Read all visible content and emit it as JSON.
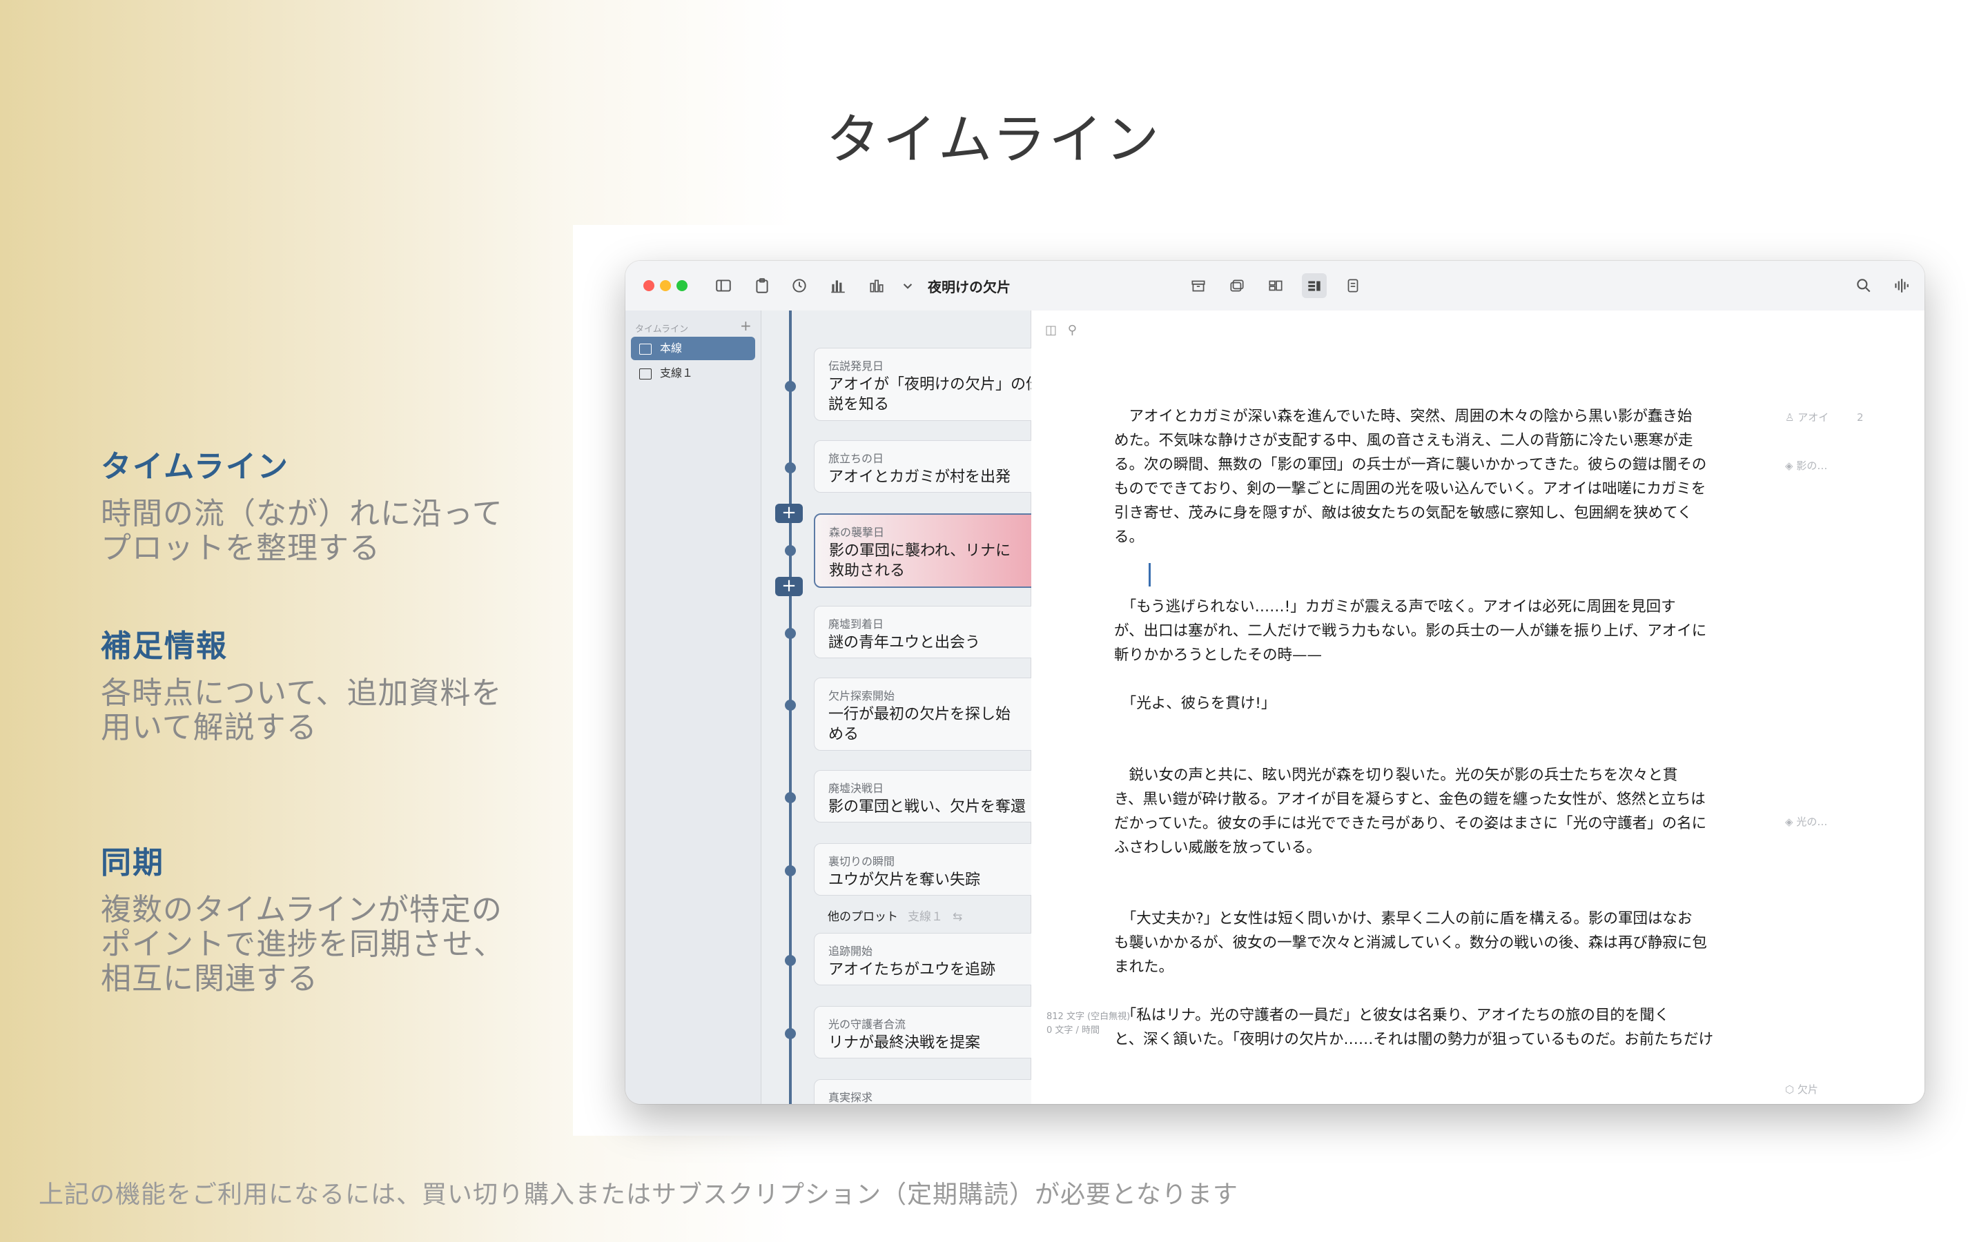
{
  "hero": {
    "title": "タイムライン"
  },
  "features": [
    {
      "title": "タイムライン",
      "desc_lines": [
        "時間の流（なが）れに沿って",
        "プロットを整理する"
      ]
    },
    {
      "title": "補足情報",
      "desc_lines": [
        "各時点について、追加資料を",
        "用いて解説する"
      ]
    },
    {
      "title": "同期",
      "desc_lines": [
        "複数のタイムラインが特定の",
        "ポイントで進捗を同期させ、",
        "相互に関連する"
      ]
    }
  ],
  "footnote": "上記の機能をご利用になるには、買い切り購入またはサブスクリプション（定期購読）が必要となります",
  "window": {
    "traffic_lights": {
      "close": "#ff5f57",
      "minimize": "#febc2e",
      "zoom": "#28c840"
    },
    "toolbar": {
      "document_title": "夜明けの欠片",
      "left_icons": [
        "sidebar-icon",
        "clipboard-icon",
        "clock-icon",
        "bar-chart-icon",
        "columns-chart-icon",
        "chevron-down-icon"
      ],
      "right_icons": [
        "archive-icon",
        "windows-icon",
        "layout-icon",
        "split-view-icon",
        "document-icon"
      ],
      "far_right_icons": [
        "search-icon",
        "waveform-icon"
      ]
    },
    "sidebar": {
      "header": "タイムライン",
      "add": "+",
      "items": [
        {
          "label": "本線",
          "selected": true
        },
        {
          "label": "支線１",
          "selected": false
        }
      ]
    },
    "timeline": {
      "cards": [
        {
          "date": "伝説発見日",
          "event": [
            "アオイが「夜明けの欠片」の伝",
            "説を知る"
          ]
        },
        {
          "date": "旅立ちの日",
          "event": [
            "アオイとカガミが村を出発"
          ]
        },
        {
          "date": "森の襲撃日",
          "event": [
            "影の軍団に襲われ、リナに",
            "救助される"
          ],
          "selected": true
        },
        {
          "date": "廃墟到着日",
          "event": [
            "謎の青年ユウと出会う"
          ]
        },
        {
          "date": "欠片探索開始",
          "event": [
            "一行が最初の欠片を探し始",
            "める"
          ]
        },
        {
          "date": "廃墟決戦日",
          "event": [
            "影の軍団と戦い、欠片を奪還"
          ]
        },
        {
          "date": "裏切りの瞬間",
          "event": [
            "ユウが欠片を奪い失踪"
          ]
        },
        {
          "date": "追跡開始",
          "event": [
            "アオイたちがユウを追跡"
          ]
        },
        {
          "date": "光の守護者合流",
          "event": [
            "リナが最終決戦を提案"
          ]
        },
        {
          "date": "真実探求",
          "event": []
        }
      ],
      "other_plot": {
        "label": "他のプロット",
        "sub": "支線１",
        "icon": "swap-icon"
      },
      "add_button": "+"
    },
    "editor": {
      "paragraphs": [
        [
          "　アオイとカガミが深い森を進んでいた時、突然、周囲の木々の陰から黒い影が蠢き始",
          "めた。不気味な静けさが支配する中、風の音さえも消え、二人の背筋に冷たい悪寒が走",
          "る。次の瞬間、無数の「影の軍団」の兵士が一斉に襲いかかってきた。彼らの鎧は闇その",
          "ものでできており、剣の一撃ごとに周囲の光を吸い込んでいく。アオイは咄嗟にカガミを",
          "引き寄せ、茂みに身を隠すが、敵は彼女たちの気配を敏感に察知し、包囲網を狭めてく",
          "る。"
        ],
        [
          "　「もう逃げられない……!」カガミが震える声で呟く。アオイは必死に周囲を見回す",
          "が、出口は塞がれ、二人だけで戦う力もない。影の兵士の一人が鎌を振り上げ、アオイに",
          "斬りかかろうとしたその時——"
        ],
        [
          "　「光よ、彼らを貫け!」"
        ],
        [
          "　鋭い女の声と共に、眩い閃光が森を切り裂いた。光の矢が影の兵士たちを次々と貫",
          "き、黒い鎧が砕け散る。アオイが目を凝らすと、金色の鎧を纏った女性が、悠然と立ちは",
          "だかっていた。彼女の手には光でできた弓があり、その姿はまさに「光の守護者」の名に",
          "ふさわしい威厳を放っている。"
        ],
        [
          "　「大丈夫か?」と女性は短く問いかけ、素早く二人の前に盾を構える。影の軍団はなお",
          "も襲いかかるが、彼女の一撃で次々と消滅していく。数分の戦いの後、森は再び静寂に包",
          "まれた。"
        ],
        [
          "　「私はリナ。光の守護者の一員だ」と彼女は名乗り、アオイたちの旅の目的を聞く",
          "と、深く頷いた。「夜明けの欠片か……それは闇の勢力が狙っているものだ。お前たちだけ"
        ]
      ],
      "margin_notes": [
        {
          "icon": "person-icon",
          "text": "アオイ",
          "count": "2"
        },
        {
          "icon": "tag-icon",
          "text": "影の…"
        },
        {
          "icon": "tag-icon",
          "text": "光の…"
        },
        {
          "icon": "cube-icon",
          "text": "欠片"
        }
      ],
      "stats": [
        "812 文字 (空白無視)",
        "0 文字 / 時間"
      ]
    }
  }
}
